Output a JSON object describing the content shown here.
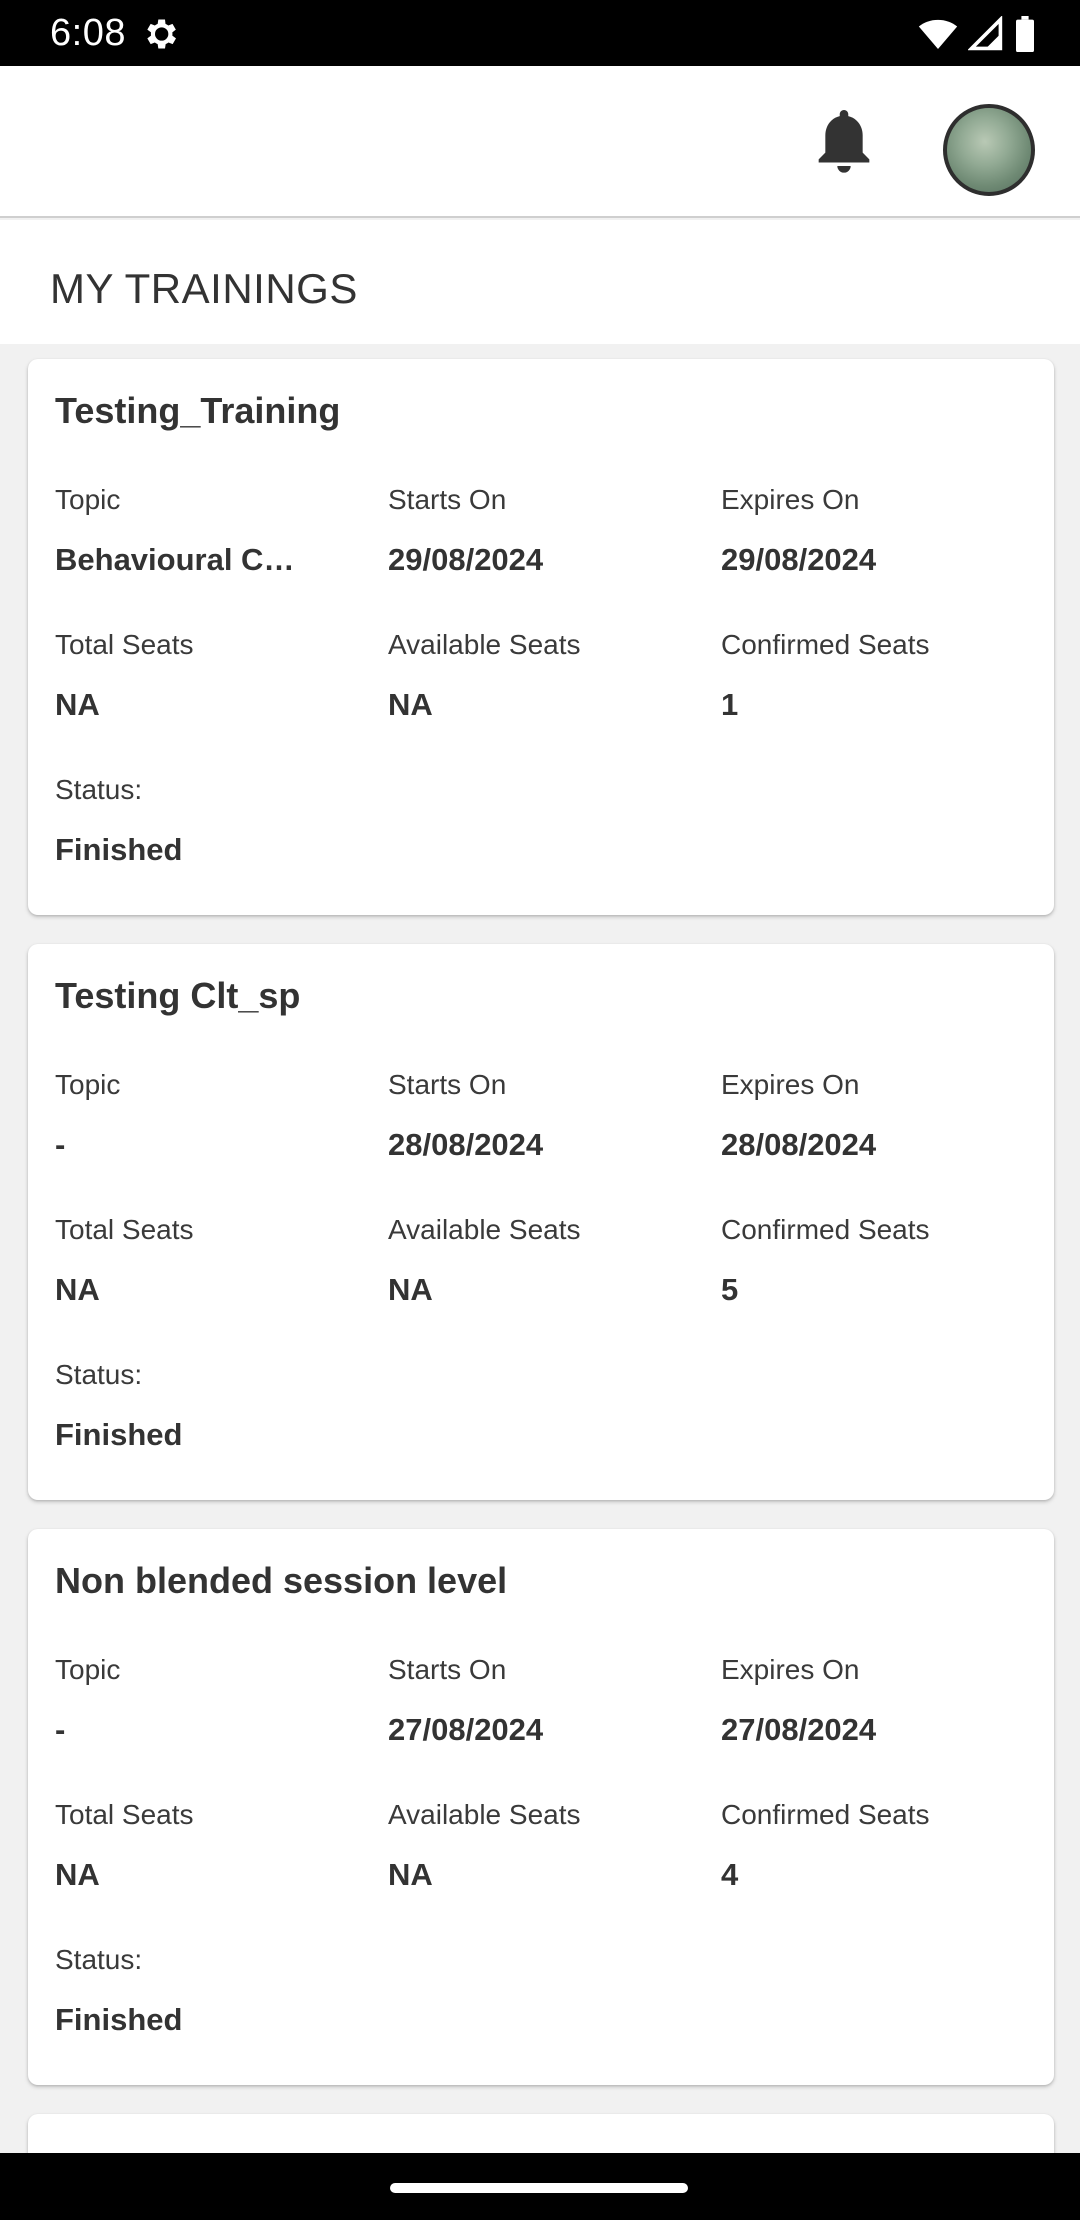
{
  "status_bar": {
    "time": "6:08",
    "icons": [
      "settings-gear-icon",
      "wifi-icon",
      "signal-icon",
      "battery-icon"
    ]
  },
  "header": {
    "icons": [
      "bell-icon",
      "avatar"
    ]
  },
  "page": {
    "title": "MY TRAININGS"
  },
  "labels": {
    "topic": "Topic",
    "starts_on": "Starts On",
    "expires_on": "Expires On",
    "total_seats": "Total Seats",
    "available_seats": "Available Seats",
    "confirmed_seats": "Confirmed Seats",
    "status": "Status:"
  },
  "trainings": [
    {
      "title": "Testing_Training",
      "topic": "Behavioural Co…",
      "starts_on": "29/08/2024",
      "expires_on": "29/08/2024",
      "total_seats": "NA",
      "available_seats": "NA",
      "confirmed_seats": "1",
      "status": "Finished"
    },
    {
      "title": "Testing Clt_sp",
      "topic": "-",
      "starts_on": "28/08/2024",
      "expires_on": "28/08/2024",
      "total_seats": "NA",
      "available_seats": "NA",
      "confirmed_seats": "5",
      "status": "Finished"
    },
    {
      "title": "Non blended session level",
      "topic": "-",
      "starts_on": "27/08/2024",
      "expires_on": "27/08/2024",
      "total_seats": "NA",
      "available_seats": "NA",
      "confirmed_seats": "4",
      "status": "Finished"
    }
  ],
  "colors": {
    "background": "#f1f1f1",
    "card": "#ffffff",
    "text": "#333333",
    "system_bar": "#000000"
  }
}
